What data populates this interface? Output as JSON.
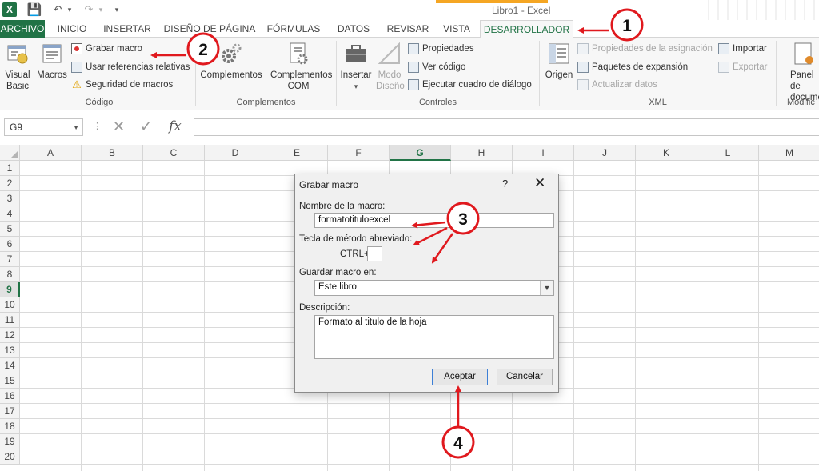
{
  "window": {
    "title": "Libro1 - Excel",
    "accent_color": "#217346"
  },
  "quick_access": {
    "app_icon": "X"
  },
  "tabs": [
    {
      "label": "ARCHIVO"
    },
    {
      "label": "INICIO"
    },
    {
      "label": "INSERTAR"
    },
    {
      "label": "DISEÑO DE PÁGINA"
    },
    {
      "label": "FÓRMULAS"
    },
    {
      "label": "DATOS"
    },
    {
      "label": "REVISAR"
    },
    {
      "label": "VISTA"
    },
    {
      "label": "DESARROLLADOR"
    }
  ],
  "ribbon": {
    "codigo": {
      "label": "Código",
      "visual_basic": "Visual Basic",
      "macros": "Macros",
      "grabar_macro": "Grabar macro",
      "usar_referencias": "Usar referencias relativas",
      "seguridad_macros": "Seguridad de macros"
    },
    "complementos": {
      "label": "Complementos",
      "complementos": "Complementos",
      "complementos_com": "Complementos COM"
    },
    "controles": {
      "label": "Controles",
      "insertar": "Insertar",
      "modo_diseno": "Modo Diseño",
      "propiedades": "Propiedades",
      "ver_codigo": "Ver código",
      "ejecutar_cuadro": "Ejecutar cuadro de diálogo"
    },
    "xml": {
      "label": "XML",
      "origen": "Origen",
      "propiedades_asignacion": "Propiedades de la asignación",
      "paquetes_expansion": "Paquetes de expansión",
      "actualizar_datos": "Actualizar datos",
      "importar": "Importar",
      "exportar": "Exportar"
    },
    "modificar": {
      "label": "Modific",
      "panel_documentos": "Panel de documen"
    }
  },
  "formula_bar": {
    "name_box": "G9",
    "fx": "fx",
    "value": ""
  },
  "grid": {
    "columns": [
      "A",
      "B",
      "C",
      "D",
      "E",
      "F",
      "G",
      "H",
      "I",
      "J",
      "K",
      "L",
      "M"
    ],
    "rows": [
      "1",
      "2",
      "3",
      "4",
      "5",
      "6",
      "7",
      "8",
      "9",
      "10",
      "11",
      "12",
      "13",
      "14",
      "15",
      "16",
      "17",
      "18",
      "19",
      "20"
    ],
    "selected_column": "G",
    "selected_row": "9"
  },
  "dialog": {
    "title": "Grabar macro",
    "help": "?",
    "nombre_label": "Nombre de la macro:",
    "nombre_value": "formatotituloexcel",
    "tecla_label": "Tecla de método abreviado:",
    "ctrl_label": "CTRL+",
    "ctrl_value": "",
    "guardar_label": "Guardar macro en:",
    "guardar_value": "Este libro",
    "descripcion_label": "Descripción:",
    "descripcion_value": "Formato al titulo de la hoja",
    "aceptar": "Aceptar",
    "cancelar": "Cancelar"
  },
  "annotations": {
    "color": "#e0191e",
    "labels": [
      "1",
      "2",
      "3",
      "4"
    ]
  }
}
